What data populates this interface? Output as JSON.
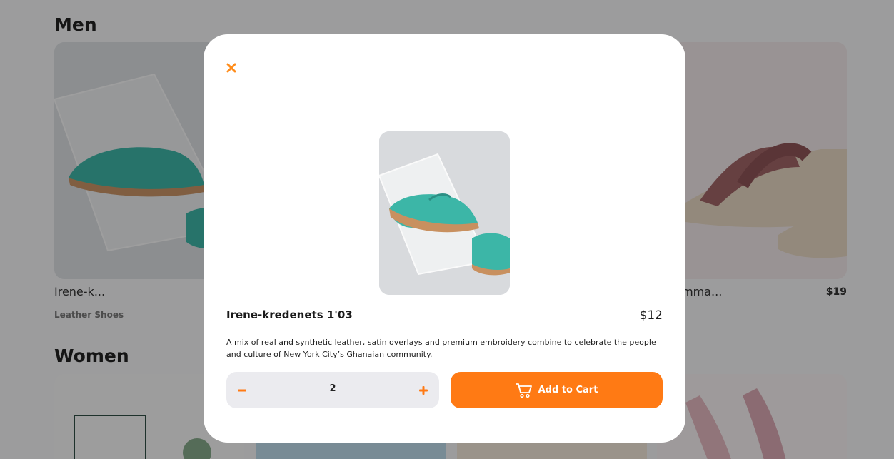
{
  "colors": {
    "accent": "#ff7a14",
    "overlay": "rgba(0,0,0,0.36)"
  },
  "background": {
    "sections": [
      {
        "title": "Men",
        "cards": [
          {
            "name": "Irene-k...",
            "category": "Leather Shoes",
            "price": ""
          },
          {
            "name": "...amma...",
            "category": "",
            "price": "$19"
          }
        ]
      },
      {
        "title": "Women"
      }
    ]
  },
  "modal": {
    "close_icon": "close-icon",
    "product": {
      "name": "Irene-kredenets 1'03",
      "price": "$12",
      "description": "A mix of real and synthetic leather, satin overlays and premium embroidery combine to celebrate the people and culture of New York City’s Ghanaian community."
    },
    "quantity": {
      "value": "2",
      "minus_icon": "minus-icon",
      "plus_icon": "plus-icon"
    },
    "add_to_cart": {
      "label": "Add to Cart",
      "icon": "cart-icon"
    }
  }
}
